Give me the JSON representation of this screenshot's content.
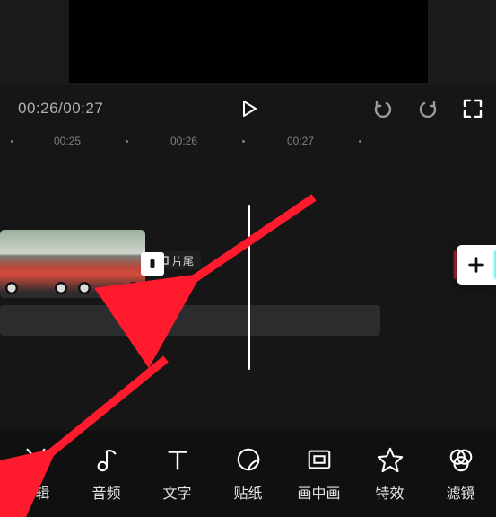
{
  "time": {
    "current": "00:26",
    "total": "00:27",
    "display": "00:26/00:27"
  },
  "ruler": {
    "t25": "00:25",
    "t26": "00:26",
    "t27": "00:27"
  },
  "tail": {
    "label": "片尾"
  },
  "add": {
    "label": "+"
  },
  "toolbar": {
    "cut": {
      "label": "剪辑"
    },
    "audio": {
      "label": "音频"
    },
    "text": {
      "label": "文字"
    },
    "sticker": {
      "label": "贴纸"
    },
    "pip": {
      "label": "画中画"
    },
    "effect": {
      "label": "特效"
    },
    "filter": {
      "label": "滤镜"
    }
  }
}
